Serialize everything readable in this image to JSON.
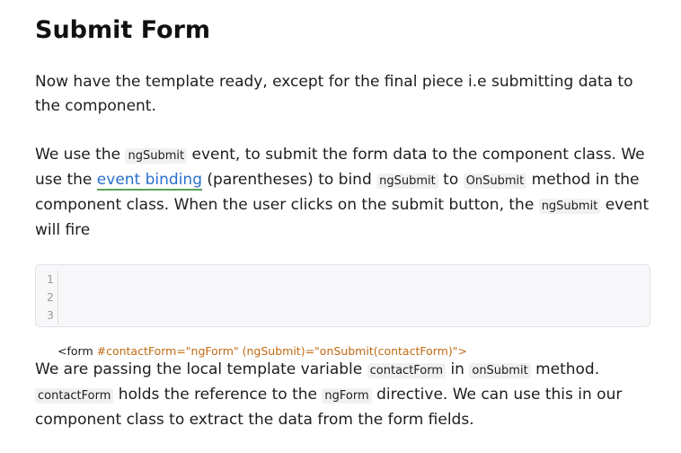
{
  "heading": "Submit Form",
  "p1": "Now have the template ready, except for the final piece i.e submitting data to the component.",
  "p2": {
    "t1": "We use the ",
    "c1": "ngSubmit",
    "t2": " event, to submit the form data to the component class. We use the ",
    "link": "event binding",
    "t3": " (parentheses) to bind ",
    "c2": "ngSubmit",
    "t4": " to ",
    "c3": "OnSubmit",
    "t5": " method in the component class. When the user clicks on the submit button, the ",
    "c4": "ngSubmit",
    "t6": " event will fire"
  },
  "code_block": {
    "line_numbers": [
      "1",
      "2",
      "3"
    ],
    "tag_open": "<form",
    "attrs": " #contactForm=\"ngForm\" (ngSubmit)=\"onSubmit(contactForm)\">"
  },
  "p3": {
    "t1": "We are passing the local template variable ",
    "c1": "contactForm",
    "t2": " in ",
    "c2": "onSubmit",
    "t3": " method. ",
    "c3": "contactForm",
    "t4": " holds the reference to the ",
    "c4": "ngForm",
    "t5": " directive. We can use this in our component class to extract the data from the form fields."
  }
}
